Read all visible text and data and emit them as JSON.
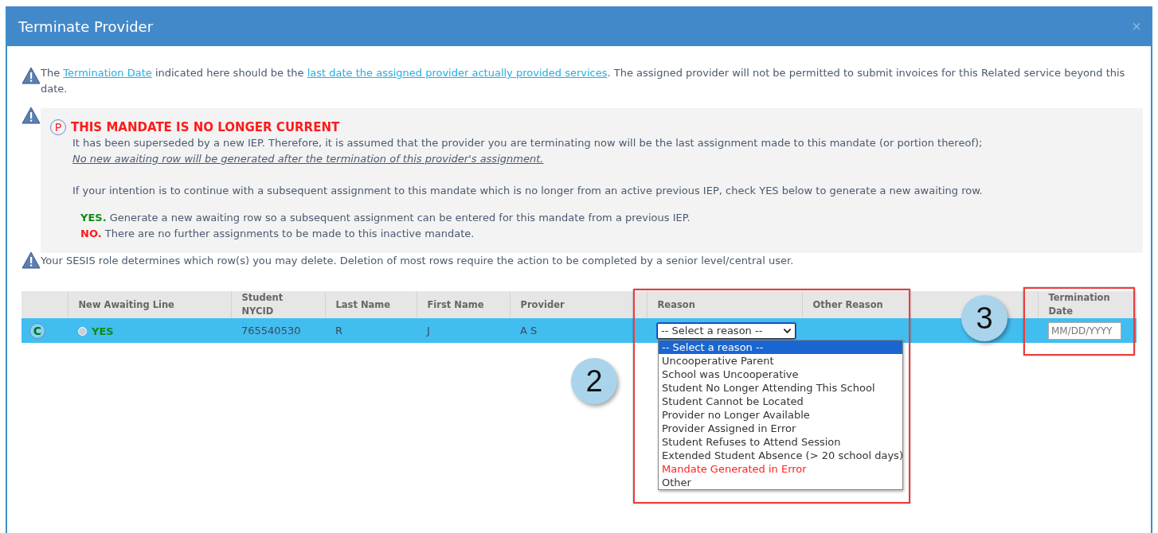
{
  "window": {
    "title": "Terminate Provider",
    "close": "×"
  },
  "notices": [
    {
      "parts": [
        "The ",
        "Termination Date",
        " indicated here should be the ",
        "last date the assigned provider actually provided services",
        ". The assigned provider will not be permitted to submit invoices for this Related service beyond this date."
      ]
    },
    {
      "badge": "P",
      "title": "THIS MANDATE IS NO LONGER CURRENT",
      "line1": "It has been superseded by a new IEP. Therefore, it is assumed that the provider you are terminating now will be the last assignment made to this mandate (or portion thereof);",
      "line2": "No new awaiting row will be generated after the termination of this provider's assignment.",
      "line3": "If your intention is to continue with a subsequent assignment to this mandate which is no longer from an active previous IEP, check YES below to generate a new awaiting row.",
      "options": [
        {
          "label": "YES.",
          "text": "Generate a new awaiting row so a subsequent assignment can be entered for this mandate from a previous IEP.",
          "color": "#118a11"
        },
        {
          "label": "NO.",
          "text": "There are no further assignments to be made to this inactive mandate.",
          "color": "#ff1a1a"
        }
      ]
    },
    {
      "text": "Your SESIS role determines which row(s) you may delete. Deletion of most rows require the action to be completed by a senior level/central user."
    }
  ],
  "table": {
    "columns": [
      "",
      "New Awaiting Line",
      "Student NYCID",
      "Last Name",
      "First Name",
      "Provider",
      "Reason",
      "Other Reason",
      "",
      "Termination Date"
    ],
    "rows": [
      {
        "selected": true,
        "marker": "C",
        "radio": {
          "selected": false,
          "label": "YES"
        },
        "nycid": "765540530",
        "last_name": "R",
        "first_name": "J",
        "provider": "A S",
        "reason": {
          "value": "-- Select a reason --",
          "expanded": true,
          "options": [
            {
              "label": "-- Select a reason --",
              "selected": true,
              "kind": "normal"
            },
            {
              "label": "Uncooperative Parent",
              "selected": false,
              "kind": "normal"
            },
            {
              "label": "School was Uncooperative",
              "selected": false,
              "kind": "normal"
            },
            {
              "label": "Student No Longer Attending This School",
              "selected": false,
              "kind": "normal"
            },
            {
              "label": "Student Cannot be Located",
              "selected": false,
              "kind": "normal"
            },
            {
              "label": "Provider no Longer Available",
              "selected": false,
              "kind": "normal"
            },
            {
              "label": "Provider Assigned in Error",
              "selected": false,
              "kind": "normal"
            },
            {
              "label": "Student Refuses to Attend Session",
              "selected": false,
              "kind": "normal"
            },
            {
              "label": "Extended Student Absence (> 20 school days)",
              "selected": false,
              "kind": "normal"
            },
            {
              "label": "Mandate Generated in Error",
              "selected": false,
              "kind": "warning"
            },
            {
              "label": "Other",
              "selected": false,
              "kind": "normal"
            }
          ]
        },
        "date": {
          "placeholder": "MM/DD/YYYY"
        }
      }
    ]
  },
  "annotations": [
    {
      "label": "2"
    },
    {
      "label": "3"
    }
  ]
}
